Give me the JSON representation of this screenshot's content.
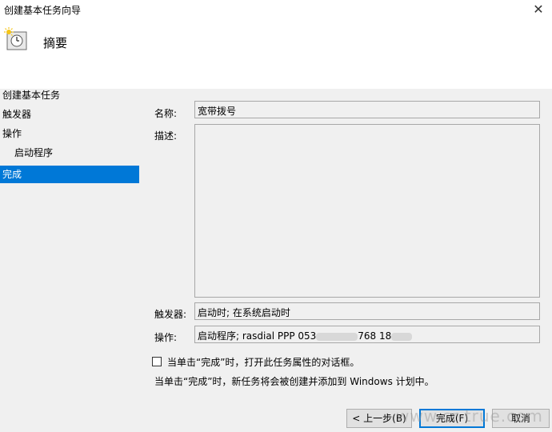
{
  "window": {
    "title": "创建基本任务向导",
    "close_glyph": "✕"
  },
  "header": {
    "title": "摘要",
    "icon": "task-clock-icon"
  },
  "sidebar": {
    "items": [
      {
        "label": "创建基本任务"
      },
      {
        "label": "触发器"
      },
      {
        "label": "操作"
      },
      {
        "label": "启动程序"
      },
      {
        "label": "完成"
      }
    ]
  },
  "form": {
    "name_label": "名称:",
    "name_value": "宽带拨号",
    "desc_label": "描述:",
    "desc_value": "",
    "trigger_label": "触发器:",
    "trigger_value": "启动时; 在系统启动时",
    "action_label": "操作:",
    "action_value_prefix": "启动程序; rasdial PPP 053",
    "action_value_mid": "768 18"
  },
  "checkbox": {
    "label": "当单击“完成”时，打开此任务属性的对话框。",
    "checked": false
  },
  "info_text": "当单击“完成”时，新任务将会被创建并添加到 Windows 计划中。",
  "buttons": {
    "back": "< 上一步(B)",
    "finish": "完成(F)",
    "cancel": "取消"
  },
  "watermark": "www.cr-true.com",
  "colors": {
    "accent": "#0078d7",
    "panel": "#f0f0f0"
  }
}
